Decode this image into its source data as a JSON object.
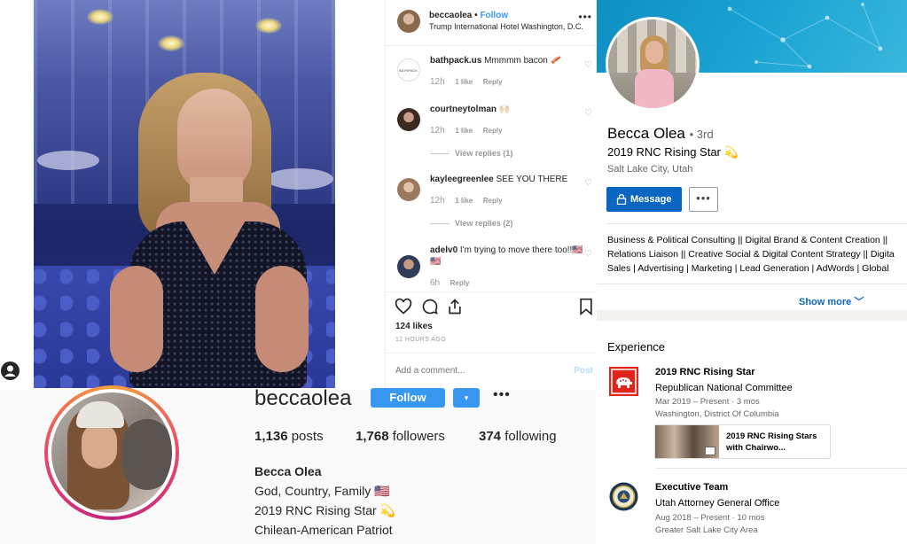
{
  "instagram_post": {
    "username": "beccaolea",
    "follow_label": "Follow",
    "location": "Trump International Hotel Washington, D.C.",
    "more_label": "•••",
    "comments": [
      {
        "user": "bathpack.us",
        "text": "Mmmmm bacon 🥓",
        "time": "12h",
        "likes": "1 like",
        "reply": "Reply"
      },
      {
        "user": "courtneytolman",
        "text": "🙌🏻",
        "time": "12h",
        "likes": "1 like",
        "reply": "Reply",
        "view_replies": "View replies (1)"
      },
      {
        "user": "kayleegreenlee",
        "text": "SEE YOU THERE",
        "time": "12h",
        "likes": "1 like",
        "reply": "Reply",
        "view_replies": "View replies (2)"
      },
      {
        "user": "adelv0",
        "text": "I'm trying to move there too!!🇺🇸🇺🇸",
        "time": "6h",
        "reply": "Reply"
      }
    ],
    "likes": "124 likes",
    "time_ago": "12 HOURS AGO",
    "comment_placeholder": "Add a comment...",
    "post_label": "Post",
    "avatar_text": "BATHPACK"
  },
  "instagram_profile": {
    "username": "beccaolea",
    "follow_label": "Follow",
    "dropdown_icon": "▾",
    "more_label": "•••",
    "stats": {
      "posts_count": "1,136",
      "posts_label": "posts",
      "followers_count": "1,768",
      "followers_label": "followers",
      "following_count": "374",
      "following_label": "following"
    },
    "bio": {
      "name": "Becca Olea",
      "line1": "God, Country, Family 🇺🇸",
      "line2": "2019 RNC Rising Star 💫",
      "line3": "Chilean-American Patriot"
    }
  },
  "linkedin": {
    "name": "Becca Olea",
    "degree": "• 3rd",
    "headline": "2019 RNC Rising Star 💫",
    "location": "Salt Lake City, Utah",
    "message_label": "Message",
    "more_label": "•••",
    "summary": [
      "Business & Political Consulting || Digital Brand & Content Creation ||",
      "Relations Liaison || Creative Social & Digital Content Strategy || Digita",
      "Sales | Advertising | Marketing | Lead Generation | AdWords | Global"
    ],
    "show_more": "Show more ﹀",
    "experience_title": "Experience",
    "experience": [
      {
        "role": "2019 RNC Rising Star",
        "org": "Republican National Committee",
        "dates": "Mar 2019 – Present · 3 mos",
        "place": "Washington, District Of Columbia",
        "media_caption": "2019 RNC Rising Stars with Chairwo..."
      },
      {
        "role": "Executive Team",
        "org": "Utah Attorney General Office",
        "dates": "Aug 2018 – Present · 10 mos",
        "place": "Greater Salt Lake City Area"
      }
    ],
    "colors": {
      "primary": "#0a66c2",
      "banner": "#1aa3d4",
      "rnc_red": "#e2231a"
    }
  },
  "icons": [
    "heart-icon",
    "comment-icon",
    "share-icon",
    "bookmark-icon",
    "lock-icon",
    "person-icon",
    "elephant-logo-icon",
    "seal-logo-icon"
  ]
}
